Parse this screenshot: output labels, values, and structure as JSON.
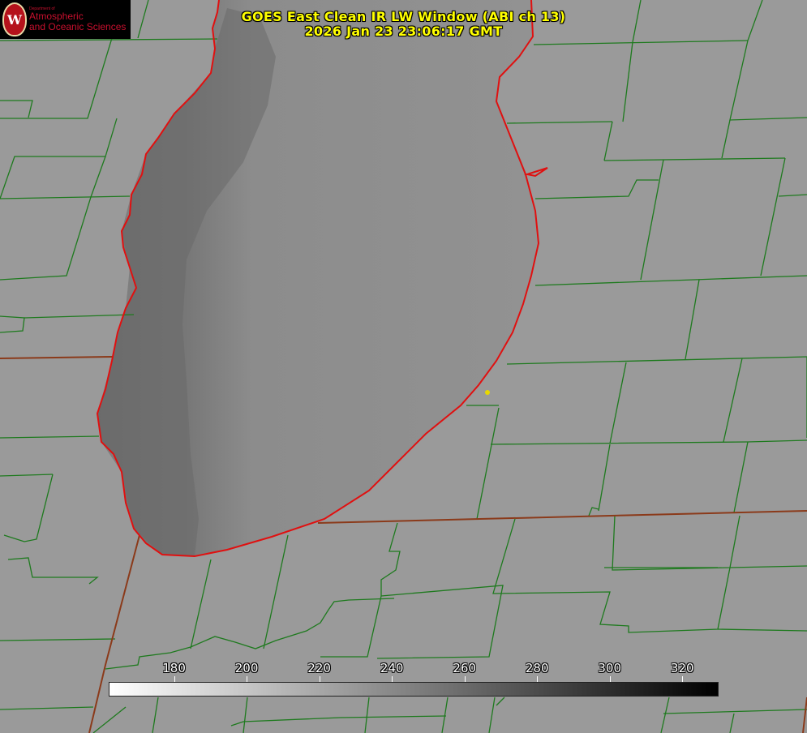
{
  "title": {
    "line1": "GOES East Clean IR LW Window (ABI ch 13)",
    "line2": "2026 Jan 23 23:06:17 GMT"
  },
  "logo": {
    "small_text": "Department of",
    "line1": "Atmospheric",
    "line2": "and Oceanic Sciences",
    "seal_letter": "W"
  },
  "colorbar": {
    "ticks": [
      "180",
      "200",
      "220",
      "240",
      "260",
      "280",
      "300",
      "320"
    ],
    "tick_values": [
      180,
      200,
      220,
      240,
      260,
      280,
      300,
      320
    ],
    "range": [
      162,
      330
    ],
    "colormap": "white-to-black"
  },
  "colors": {
    "title": "#ffff00",
    "county_lines": "#1e7a1e",
    "state_lines": "#8b3a1a",
    "coastline": "#e01010",
    "land": "#9a9a9a",
    "lake_shallow": "#6c6c6c",
    "lake_deep": "#8f8f8f",
    "marker": "#e8d800"
  }
}
